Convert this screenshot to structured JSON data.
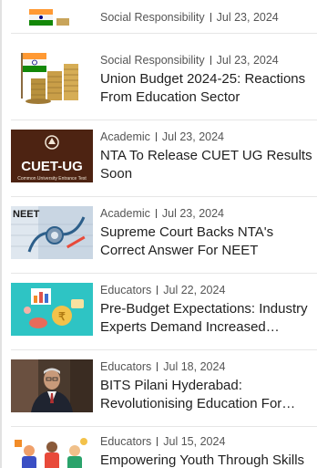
{
  "articles": [
    {
      "category": "Social Responsibility",
      "date": "Jul 23, 2024",
      "title": "",
      "thumb": "india-flag-coins"
    },
    {
      "category": "Social Responsibility",
      "date": "Jul 23, 2024",
      "title": "Union Budget 2024-25: Reactions From Education Sector",
      "thumb": "india-flag-coins"
    },
    {
      "category": "Academic",
      "date": "Jul 23, 2024",
      "title": "NTA To Release CUET UG Results Soon",
      "thumb": "cuet-ug-logo",
      "thumb_text": "CUET-UG",
      "thumb_subtext": "Common University Entrance Test"
    },
    {
      "category": "Academic",
      "date": "Jul 23, 2024",
      "title": "Supreme Court Backs NTA's Correct Answer For NEET",
      "thumb": "neet-stethoscope",
      "thumb_text": "NEET"
    },
    {
      "category": "Educators",
      "date": "Jul 22, 2024",
      "title": "Pre-Budget Expectations: Industry Experts Demand Increased…",
      "thumb": "budget-illustration"
    },
    {
      "category": "Educators",
      "date": "Jul 18, 2024",
      "title": "BITS Pilani Hyderabad: Revolutionising Education For…",
      "thumb": "person-portrait"
    },
    {
      "category": "Educators",
      "date": "Jul 15, 2024",
      "title": "Empowering Youth Through Skills",
      "thumb": "youth-illustration"
    }
  ],
  "colors": {
    "saffron": "#ff9933",
    "green": "#138808",
    "navy": "#000080",
    "teal": "#2ec4c4"
  }
}
